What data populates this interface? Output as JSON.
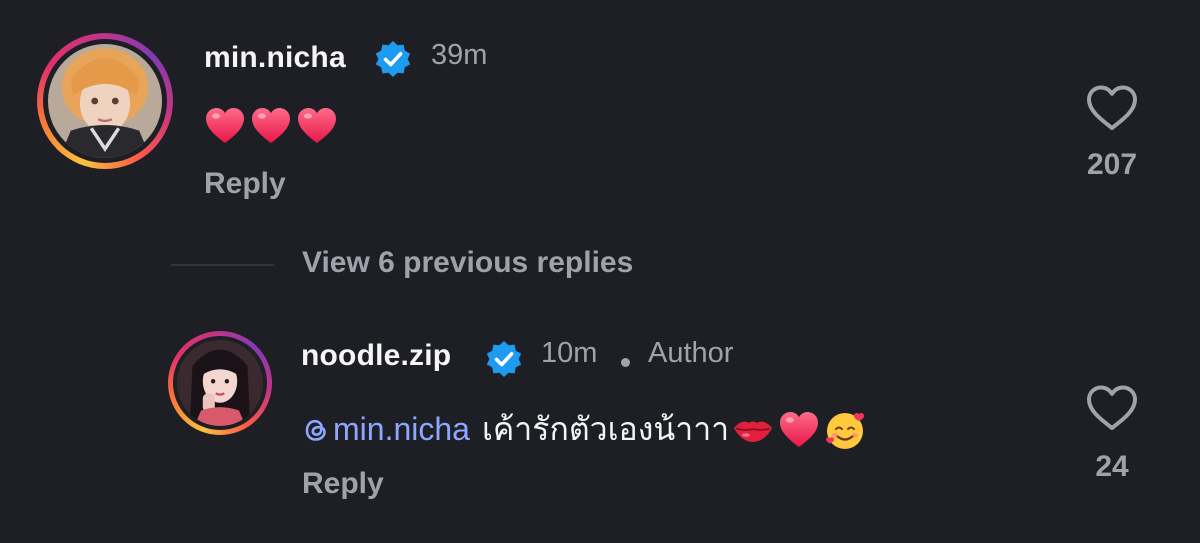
{
  "comment1": {
    "username": "min.nicha",
    "time": "39m",
    "emojis": [
      "heart",
      "heart",
      "heart"
    ],
    "reply_label": "Reply",
    "likes": "207"
  },
  "view_replies": "View 6 previous replies",
  "comment2": {
    "username": "noodle.zip",
    "time": "10m",
    "author_label": "Author",
    "mention": "min.nicha",
    "text": "เค้ารักตัวเองน้าาา",
    "emojis": [
      "lips",
      "heart",
      "smiling-face-with-hearts"
    ],
    "reply_label": "Reply",
    "likes": "24"
  },
  "colors": {
    "background": "#1e1f24",
    "verified": "#1d9bf0",
    "muted": "#9ea3ab",
    "mention": "#8ea6ff",
    "heart_emoji": "#f0365a"
  }
}
